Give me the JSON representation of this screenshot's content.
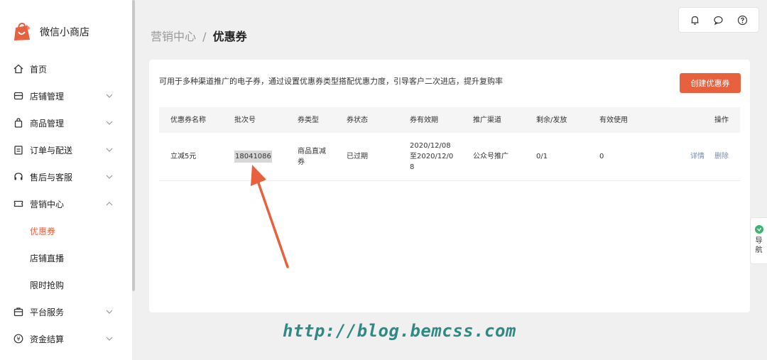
{
  "app": {
    "title": "微信小商店"
  },
  "sidebar": {
    "items": [
      {
        "label": "首页",
        "icon": "home-icon",
        "expandable": false
      },
      {
        "label": "店铺管理",
        "icon": "store-icon",
        "expandable": true
      },
      {
        "label": "商品管理",
        "icon": "bag-icon",
        "expandable": true
      },
      {
        "label": "订单与配送",
        "icon": "order-icon",
        "expandable": true
      },
      {
        "label": "售后与客服",
        "icon": "headset-icon",
        "expandable": true
      },
      {
        "label": "营销中心",
        "icon": "ticket-icon",
        "expandable": true,
        "expanded": true
      }
    ],
    "subitems": [
      {
        "label": "优惠券",
        "active": true
      },
      {
        "label": "店铺直播",
        "active": false
      },
      {
        "label": "限时抢购",
        "active": false
      }
    ],
    "items_after": [
      {
        "label": "平台服务",
        "icon": "platform-icon"
      },
      {
        "label": "资金结算",
        "icon": "yen-icon"
      }
    ]
  },
  "breadcrumb": {
    "parent": "营销中心",
    "separator": "/",
    "current": "优惠券"
  },
  "top_actions": [
    "bell-icon",
    "chat-icon",
    "help-icon"
  ],
  "card": {
    "description": "可用于多种渠道推广的电子券，通过设置优惠券类型搭配优惠力度，引导客户二次进店，提升复购率",
    "create_button": "创建优惠券"
  },
  "table": {
    "columns": [
      "优惠券名称",
      "批次号",
      "券类型",
      "券状态",
      "券有效期",
      "推广渠道",
      "剩余/发放",
      "有效使用",
      "操作"
    ],
    "rows": [
      {
        "name": "立减5元",
        "batch": "18041086",
        "type": "商品直减券",
        "status": "已过期",
        "validity": "2020/12/08至2020/12/08",
        "channel": "公众号推广",
        "remaining": "0/1",
        "used": "0",
        "actions": [
          "详情",
          "删除"
        ]
      }
    ]
  },
  "side_nav": {
    "line1": "导",
    "line2": "航"
  },
  "watermark": "http://blog.bemcss.com",
  "colors": {
    "accent": "#e8613f",
    "link": "#7b8bb0",
    "watermark": "#2f8a87",
    "nav_dot": "#3cb371"
  }
}
